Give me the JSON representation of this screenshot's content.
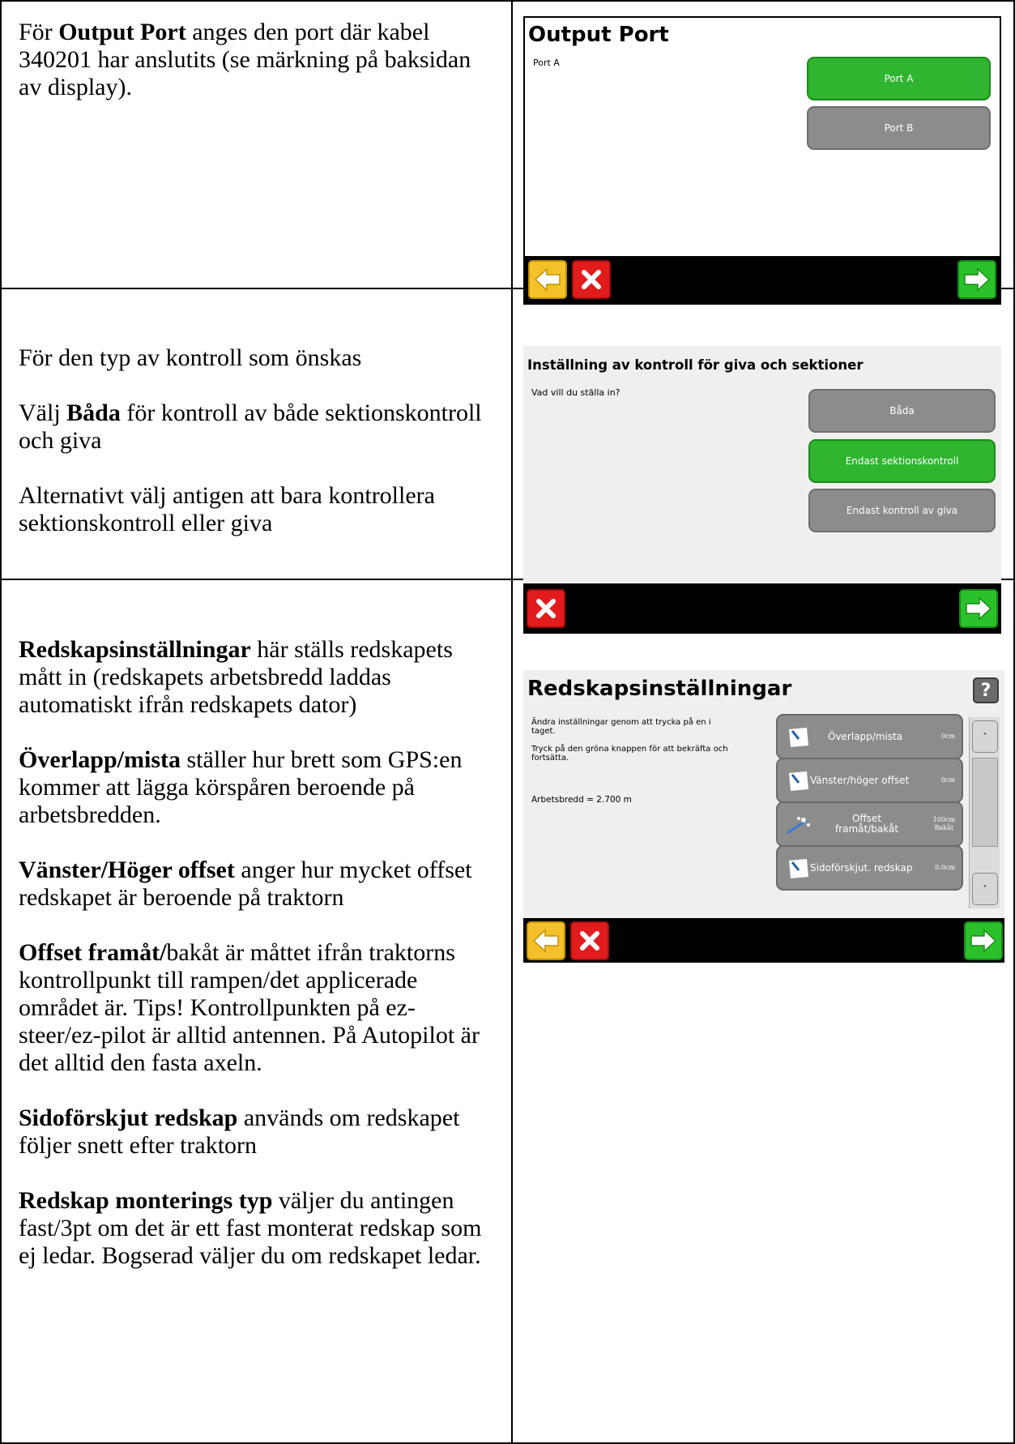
{
  "rows": [
    {
      "paragraphs": [
        [
          {
            "b": false,
            "t": "För "
          },
          {
            "b": true,
            "t": "Output Port"
          },
          {
            "b": false,
            "t": " anges den port där kabel 340201 har anslutits (se märkning på baksidan av display)."
          }
        ]
      ]
    },
    {
      "paragraphs": [
        [
          {
            "b": false,
            "t": "För den typ av kontroll som önskas"
          }
        ],
        [
          {
            "b": false,
            "t": "Välj "
          },
          {
            "b": true,
            "t": "Båda"
          },
          {
            "b": false,
            "t": " för kontroll av både sektionskontroll och giva"
          }
        ],
        [
          {
            "b": false,
            "t": "Alternativt välj antigen att bara kontrollera sektionskontroll eller giva"
          }
        ]
      ]
    },
    {
      "paragraphs": [
        [
          {
            "b": true,
            "t": "Redskapsinställningar"
          },
          {
            "b": false,
            "t": " här ställs redskapets mått in (redskapets arbetsbredd laddas automatiskt ifrån redskapets dator)"
          }
        ],
        [
          {
            "b": true,
            "t": "Överlapp/mista"
          },
          {
            "b": false,
            "t": " ställer hur brett som GPS:en kommer att lägga körspåren beroende på arbetsbredden."
          }
        ],
        [
          {
            "b": true,
            "t": "Vänster/Höger offset"
          },
          {
            "b": false,
            "t": " anger hur mycket offset redskapet är beroende på traktorn"
          }
        ],
        [
          {
            "b": true,
            "t": "Offset framåt/"
          },
          {
            "b": false,
            "t": "bakåt är måttet ifrån traktorns kontrollpunkt till rampen/det applicerade området är. Tips! Kontrollpunkten på ez-steer/ez-pilot är alltid antennen. På Autopilot är det alltid den fasta axeln."
          }
        ],
        [
          {
            "b": true,
            "t": "Sidoförskjut redskap"
          },
          {
            "b": false,
            "t": " används om redskapet följer snett efter traktorn"
          }
        ],
        [
          {
            "b": true,
            "t": "Redskap monterings typ"
          },
          {
            "b": false,
            "t": " väljer du antingen fast/3pt om det är ett fast monterat redskap som ej ledar. Bogserad väljer du om redskapet ledar."
          }
        ]
      ]
    }
  ],
  "screen1": {
    "title": "Output Port",
    "current": "Port A",
    "options": [
      {
        "label": "Port A",
        "state": "selected"
      },
      {
        "label": "Port B",
        "state": "unselected"
      }
    ],
    "nav": [
      "back-arrow-icon",
      "cancel-x-icon",
      "next-arrow-icon"
    ]
  },
  "screen2": {
    "title": "Inställning av kontroll för giva och sektioner",
    "prompt": "Vad vill du ställa in?",
    "options": [
      {
        "label": "Båda",
        "state": "unselected"
      },
      {
        "label": "Endast sektionskontroll",
        "state": "selected"
      },
      {
        "label": "Endast kontroll av giva",
        "state": "unselected"
      }
    ],
    "nav": [
      "cancel-x-icon",
      "next-arrow-icon"
    ]
  },
  "screen3": {
    "title": "Redskapsinställningar",
    "help_icon": "?",
    "instructions1": "Ändra inställningar genom att trycka på en i taget.",
    "instructions2": "Tryck på den gröna knappen för att bekräfta och fortsätta.",
    "workwidth": "Arbetsbredd = 2.700 m",
    "settings": [
      {
        "label": "Överlapp/mista",
        "value": "0cm"
      },
      {
        "label": "Vänster/höger offset",
        "value": "0cm"
      },
      {
        "label": "Offset framåt/bakåt",
        "value": "100cm",
        "value2": "Bakåt"
      },
      {
        "label": "Sidoförskjut. redskap",
        "value": "0.0cm"
      }
    ],
    "scroll_up": "˄",
    "scroll_down": "˅",
    "nav": [
      "back-arrow-icon",
      "cancel-x-icon",
      "next-arrow-icon"
    ]
  },
  "colors": {
    "selected_button": "#2fb52f",
    "unselected_button": "#8c8c8c",
    "back_button": "#f5c12a",
    "cancel_button": "#e21c1c",
    "next_button": "#2bc12b"
  }
}
